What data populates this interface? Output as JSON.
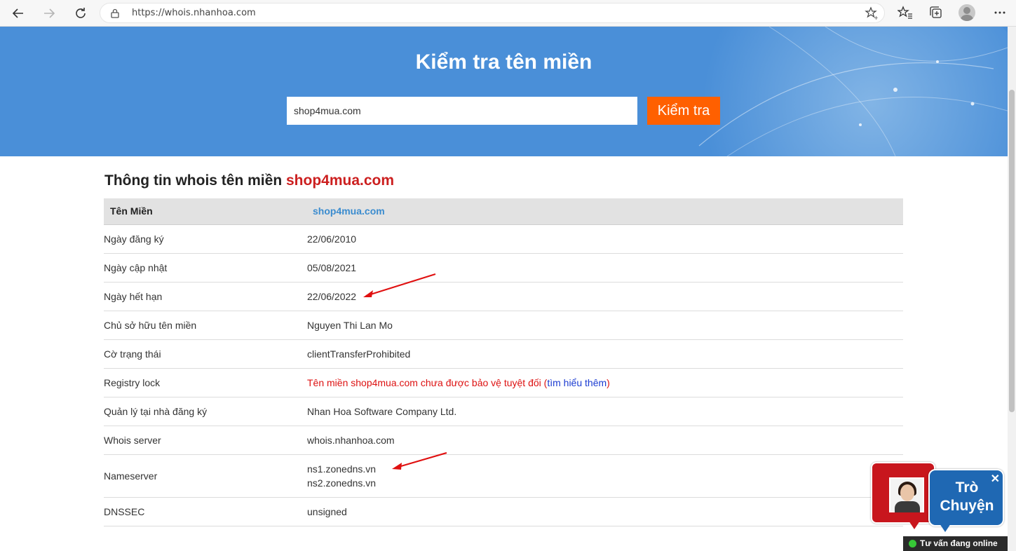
{
  "browser": {
    "url": "https://whois.nhanhoa.com"
  },
  "hero": {
    "title": "Kiểm tra tên miền",
    "search_value": "shop4mua.com",
    "search_button": "Kiểm tra"
  },
  "whois": {
    "heading_prefix": "Thông tin whois tên miền",
    "heading_domain": "shop4mua.com",
    "header_label": "Tên Miền",
    "header_value": "shop4mua.com",
    "rows": [
      {
        "label": "Ngày đăng ký",
        "value": "22/06/2010"
      },
      {
        "label": "Ngày cập nhật",
        "value": "05/08/2021"
      },
      {
        "label": "Ngày hết hạn",
        "value": "22/06/2022"
      },
      {
        "label": "Chủ sở hữu tên miền",
        "value": "Nguyen Thi Lan Mo"
      },
      {
        "label": "Cờ trạng thái",
        "value": "clientTransferProhibited"
      },
      {
        "label": "Registry lock",
        "value_prefix": "Tên miền shop4mua.com chưa được bảo vệ tuyệt đối (",
        "link": "tìm hiểu thêm",
        "value_suffix": ")"
      },
      {
        "label": "Quản lý tại nhà đăng ký",
        "value": "Nhan Hoa Software Company Ltd."
      },
      {
        "label": "Whois server",
        "value": "whois.nhanhoa.com"
      },
      {
        "label": "Nameserver",
        "values": [
          "ns1.zonedns.vn",
          "ns2.zonedns.vn"
        ]
      },
      {
        "label": "DNSSEC",
        "value": "unsigned"
      }
    ]
  },
  "chat": {
    "bubble_line1": "Trò",
    "bubble_line2": "Chuyện",
    "close": "✕",
    "status": "Tư vấn đang online"
  },
  "colors": {
    "hero_bg": "#4a8fd8",
    "button": "#ff6000",
    "domain_red": "#cc1f1f",
    "link_blue": "#3b8ccf"
  }
}
